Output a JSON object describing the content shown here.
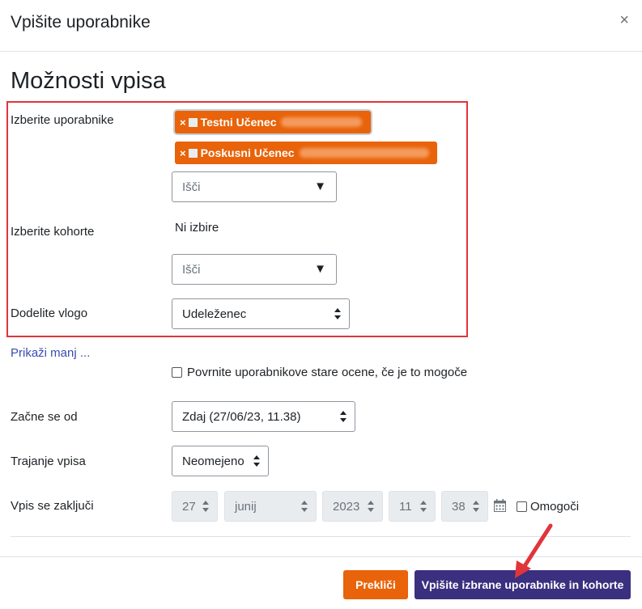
{
  "modal": {
    "title": "Vpišite uporabnike",
    "close_glyph": "×"
  },
  "section_title": "Možnosti vpisa",
  "fields": {
    "select_users": {
      "label": "Izberite uporabnike",
      "selected": [
        {
          "name": "Testni Učenec",
          "remove_glyph": "×"
        },
        {
          "name": "Poskusni Učenec",
          "remove_glyph": "×"
        }
      ],
      "search_placeholder": "Išči"
    },
    "select_cohorts": {
      "label": "Izberite kohorte",
      "none_text": "Ni izbire",
      "search_placeholder": "Išči"
    },
    "assign_role": {
      "label": "Dodelite vlogo",
      "value": "Udeleženec"
    }
  },
  "show_less_link": "Prikaži manj ...",
  "recover_grades": {
    "label": "Povrnite uporabnikove stare ocene, če je to mogoče",
    "checked": false
  },
  "starts_from": {
    "label": "Začne se od",
    "value": "Zdaj (27/06/23, 11.38)"
  },
  "duration": {
    "label": "Trajanje vpisa",
    "value": "Neomejeno"
  },
  "enrol_ends": {
    "label": "Vpis se zaključi",
    "day": "27",
    "month": "junij",
    "year": "2023",
    "hour": "11",
    "minute": "38",
    "enable_label": "Omogoči",
    "enabled": false
  },
  "buttons": {
    "cancel": "Prekliči",
    "submit": "Vpišite izbrane uporabnike in kohorte"
  },
  "colors": {
    "accent_orange": "#e8630a",
    "primary_purple": "#3b2f7f",
    "highlight_red": "#e0353a",
    "link_blue": "#3a4bb0"
  },
  "icons": {
    "caret": "▼",
    "close": "close-icon",
    "calendar": "calendar-icon"
  }
}
